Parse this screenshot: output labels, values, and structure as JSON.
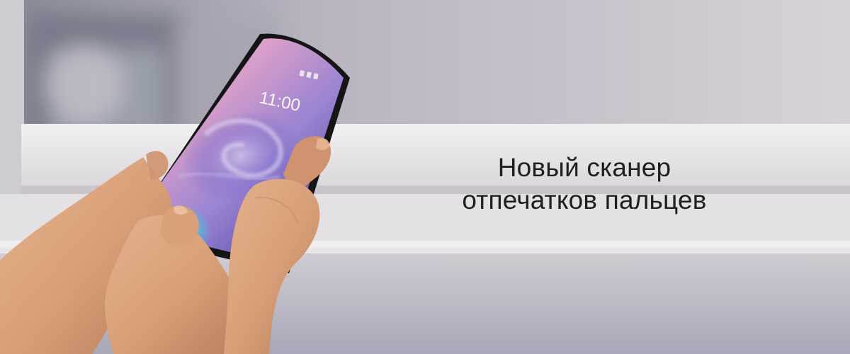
{
  "headline": {
    "line1": "Новый сканер",
    "line2": "отпечатков пальцев"
  },
  "phone": {
    "clock": "11:00"
  },
  "colors": {
    "text": "#1f1f1f",
    "background": "#d6d2d8",
    "screen_purple": "#8c74c9",
    "screen_pink": "#f0a9c8",
    "fingerprint_glow": "#49c2d8",
    "skin": "#d9a179"
  },
  "icons": {
    "fingerprint": "fingerprint-icon",
    "phone_call": "phone-call-icon"
  }
}
